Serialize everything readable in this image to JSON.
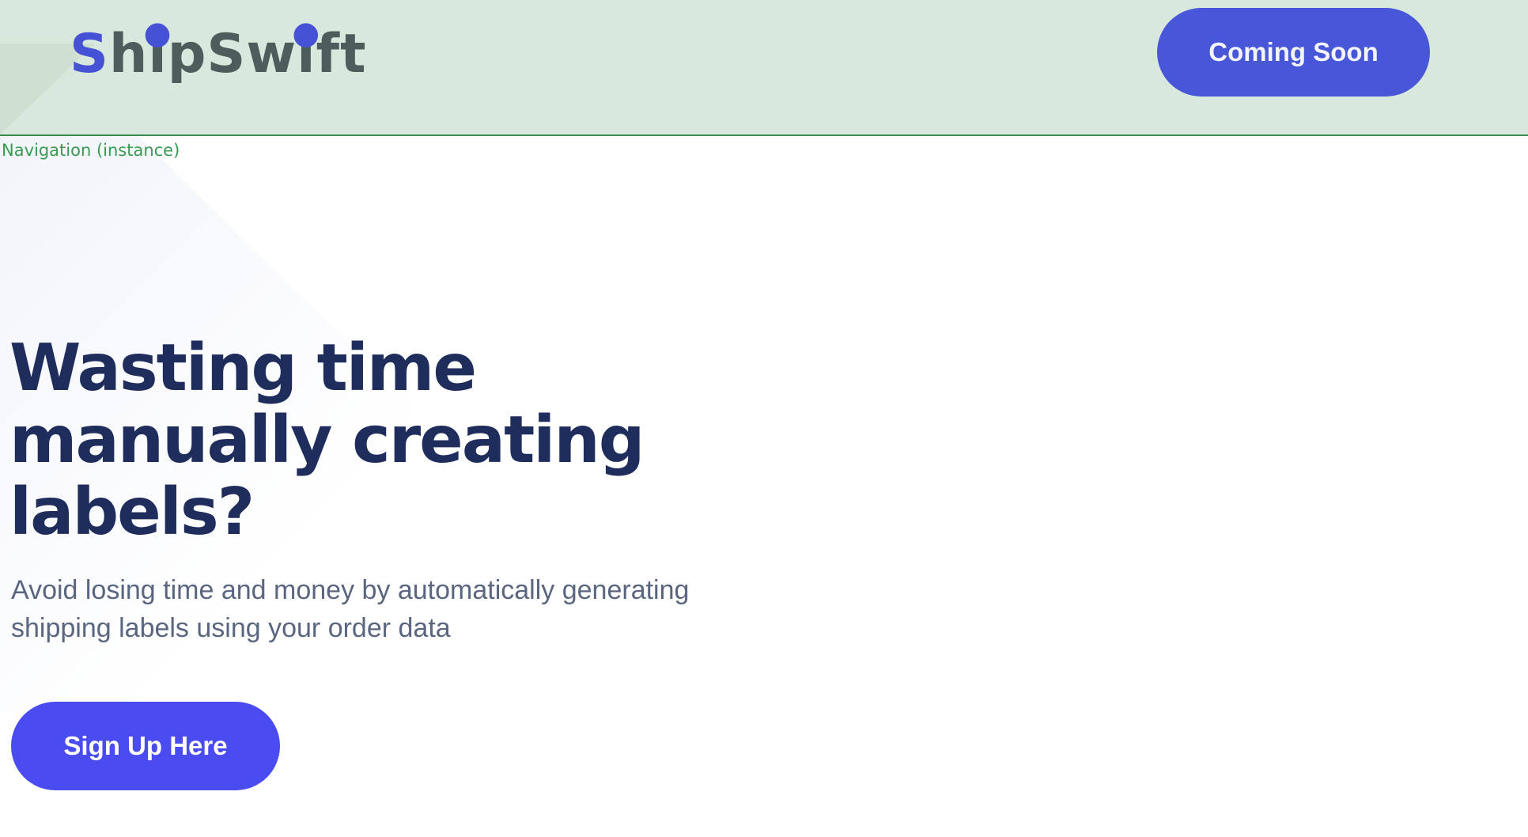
{
  "nav": {
    "logo_first_letter": "S",
    "logo_rest_1": "h",
    "logo_i_stem": "ı",
    "logo_rest_2": "pSw",
    "logo_rest_3": "ft",
    "logo_text": "ShipSwift",
    "coming_soon_label": "Coming Soon",
    "caption": "Navigation (instance)"
  },
  "hero": {
    "title_line_1": "Wasting time",
    "title_line_2": "manually creating",
    "title_line_3": "labels?",
    "subtitle_line_1": "Avoid losing time and money by automatically generating",
    "subtitle_line_2": "shipping labels using your order data",
    "signup_label": "Sign Up Here"
  },
  "colors": {
    "nav_background": "#d9e8dc",
    "nav_border": "#3a8a4c",
    "brand_accent": "#4552d6",
    "logo_text": "#4d5d5c",
    "primary_button": "#4a4cf2",
    "nav_button": "#4757d7",
    "heading": "#1f2d5c",
    "subtitle": "#5a6680",
    "caption": "#3a9a52"
  }
}
